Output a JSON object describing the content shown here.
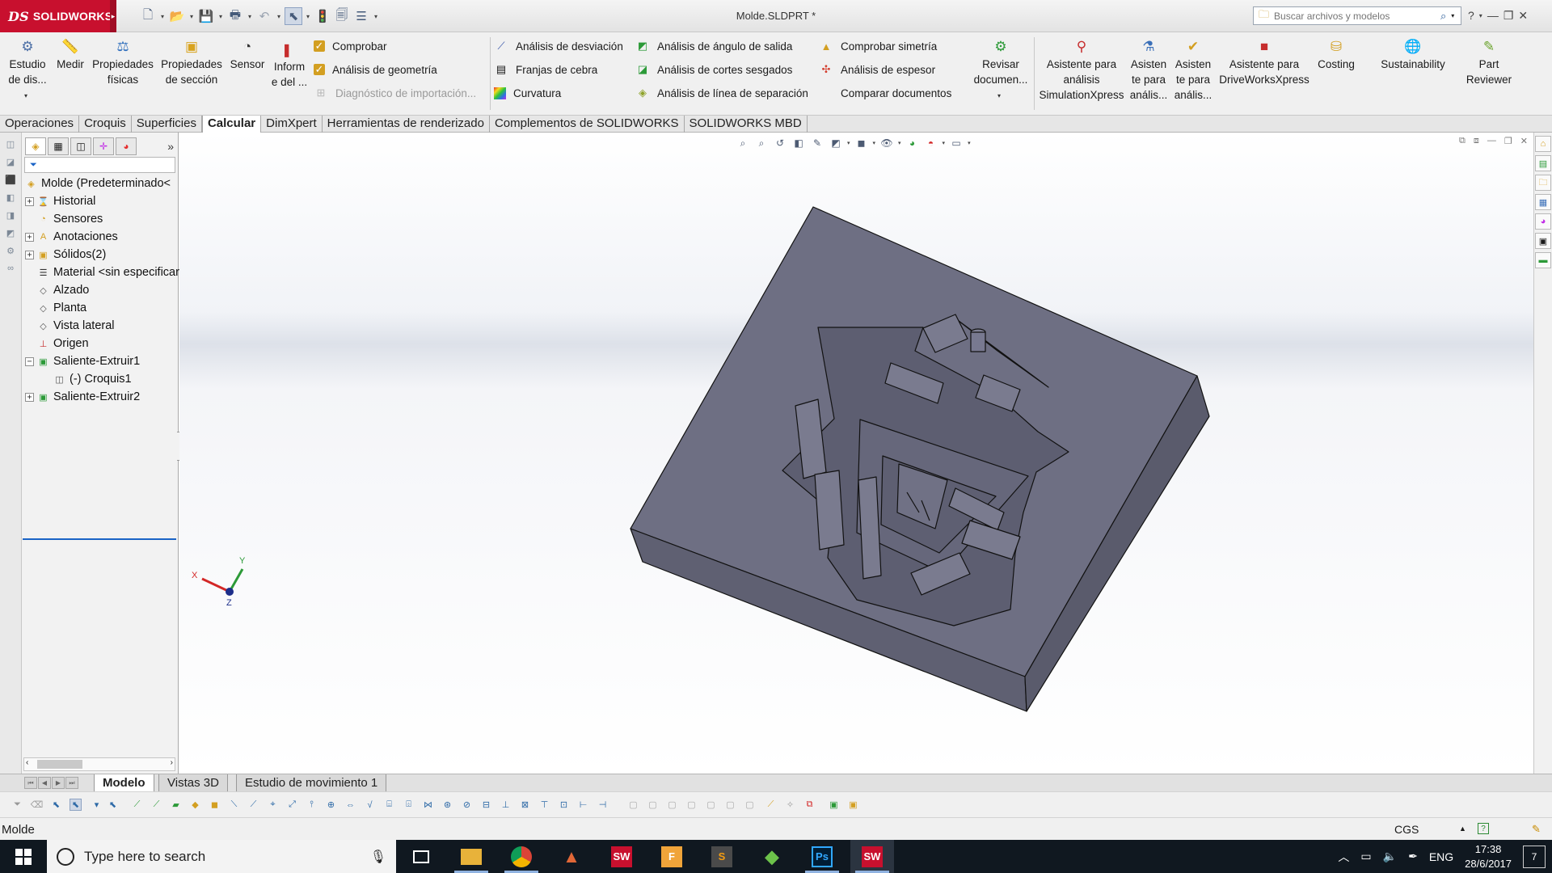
{
  "window": {
    "app_name": "SOLIDWORKS",
    "document_title": "Molde.SLDPRT *",
    "search_placeholder": "Buscar archivos y modelos"
  },
  "ribbon": {
    "big_buttons": [
      {
        "label_lines": [
          "Estudio",
          "de dis..."
        ],
        "icon": "design-study-icon"
      },
      {
        "label_lines": [
          "Medir"
        ],
        "icon": "measure-icon"
      },
      {
        "label_lines": [
          "Propiedades",
          "físicas"
        ],
        "icon": "mass-properties-icon"
      },
      {
        "label_lines": [
          "Propiedades",
          "de sección"
        ],
        "icon": "section-properties-icon"
      },
      {
        "label_lines": [
          "Sensor"
        ],
        "icon": "sensor-icon"
      },
      {
        "label_lines": [
          "Inform",
          "e del ..."
        ],
        "icon": "report-icon"
      }
    ],
    "check_items": [
      {
        "label": "Comprobar",
        "enabled": true
      },
      {
        "label": "Análisis de geometría",
        "enabled": true
      },
      {
        "label": "Diagnóstico de importación...",
        "enabled": false
      }
    ],
    "analysis_col1": [
      "Análisis de desviación",
      "Franjas de cebra",
      "Curvatura"
    ],
    "analysis_col2": [
      "Análisis de ángulo de salida",
      "Análisis de cortes sesgados",
      "Análisis de línea de separación"
    ],
    "analysis_col3": [
      "Comprobar simetría",
      "Análisis de espesor",
      "Comparar documentos"
    ],
    "revisar": [
      "Revisar",
      "documen..."
    ],
    "addins": [
      {
        "label_lines": [
          "Asistente para",
          "análisis",
          "SimulationXpress"
        ],
        "icon": "simulationxpress-icon"
      },
      {
        "label_lines": [
          "Asisten",
          "te para",
          "anális..."
        ],
        "icon": "floxpress-icon"
      },
      {
        "label_lines": [
          "Asisten",
          "te para",
          "anális..."
        ],
        "icon": "dfmxpress-icon"
      },
      {
        "label_lines": [
          "Asistente para",
          "DriveWorksXpress"
        ],
        "icon": "driveworksxpress-icon"
      },
      {
        "label_lines": [
          "Costing"
        ],
        "icon": "costing-icon"
      },
      {
        "label_lines": [
          "Sustainability"
        ],
        "icon": "sustainability-icon"
      },
      {
        "label_lines": [
          "Part",
          "Reviewer"
        ],
        "icon": "part-reviewer-icon"
      }
    ]
  },
  "tabs": [
    "Operaciones",
    "Croquis",
    "Superficies",
    "Calcular",
    "DimXpert",
    "Herramientas de renderizado",
    "Complementos de SOLIDWORKS",
    "SOLIDWORKS MBD"
  ],
  "active_tab": "Calcular",
  "tree": {
    "root": "Molde  (Predeterminado<",
    "items": [
      {
        "label": "Historial",
        "expander": "+",
        "icon": "history-icon",
        "indent": 0
      },
      {
        "label": "Sensores",
        "expander": "",
        "icon": "sensors-icon",
        "indent": 0
      },
      {
        "label": "Anotaciones",
        "expander": "+",
        "icon": "annotations-icon",
        "indent": 0
      },
      {
        "label": "Sólidos(2)",
        "expander": "+",
        "icon": "solid-bodies-icon",
        "indent": 0
      },
      {
        "label": "Material <sin especificar>",
        "expander": "",
        "icon": "material-icon",
        "indent": 0
      },
      {
        "label": "Alzado",
        "expander": "",
        "icon": "plane-icon",
        "indent": 0
      },
      {
        "label": "Planta",
        "expander": "",
        "icon": "plane-icon",
        "indent": 0
      },
      {
        "label": "Vista lateral",
        "expander": "",
        "icon": "plane-icon",
        "indent": 0
      },
      {
        "label": "Origen",
        "expander": "",
        "icon": "origin-icon",
        "indent": 0
      },
      {
        "label": "Saliente-Extruir1",
        "expander": "−",
        "icon": "extrude-icon",
        "indent": 0
      },
      {
        "label": "(-) Croquis1",
        "expander": "",
        "icon": "sketch-icon",
        "indent": 1
      },
      {
        "label": "Saliente-Extruir2",
        "expander": "+",
        "icon": "extrude-icon",
        "indent": 0
      }
    ]
  },
  "triad": {
    "x": "X",
    "y": "Y",
    "z": "Z"
  },
  "bottom_tabs": [
    "Modelo",
    "Vistas 3D",
    "Estudio de movimiento 1"
  ],
  "active_bottom_tab": "Modelo",
  "status": {
    "document": "Molde",
    "units": "CGS"
  },
  "taskbar": {
    "search_placeholder": "Type here to search",
    "language": "ENG",
    "time": "17:38",
    "date": "28/6/2017",
    "notification_count": "7",
    "apps": [
      {
        "name": "task-view",
        "icon": "task-view-icon"
      },
      {
        "name": "file-explorer",
        "icon": "file-explorer-icon"
      },
      {
        "name": "chrome",
        "icon": "chrome-icon"
      },
      {
        "name": "matlab",
        "icon": "matlab-icon"
      },
      {
        "name": "solidworks-2015",
        "icon": "solidworks-icon"
      },
      {
        "name": "foxit",
        "icon": "foxit-icon"
      },
      {
        "name": "sublime",
        "icon": "sublime-icon"
      },
      {
        "name": "git",
        "icon": "git-icon"
      },
      {
        "name": "photoshop",
        "icon": "photoshop-icon"
      },
      {
        "name": "solidworks-2017",
        "icon": "solidworks-active-icon"
      }
    ]
  },
  "colors": {
    "brand": "#c8102e",
    "model_face_top": "#6d6e82",
    "model_face_side": "#5a5b6c",
    "tree_selection": "#1a63c6",
    "taskbar": "#101820"
  }
}
